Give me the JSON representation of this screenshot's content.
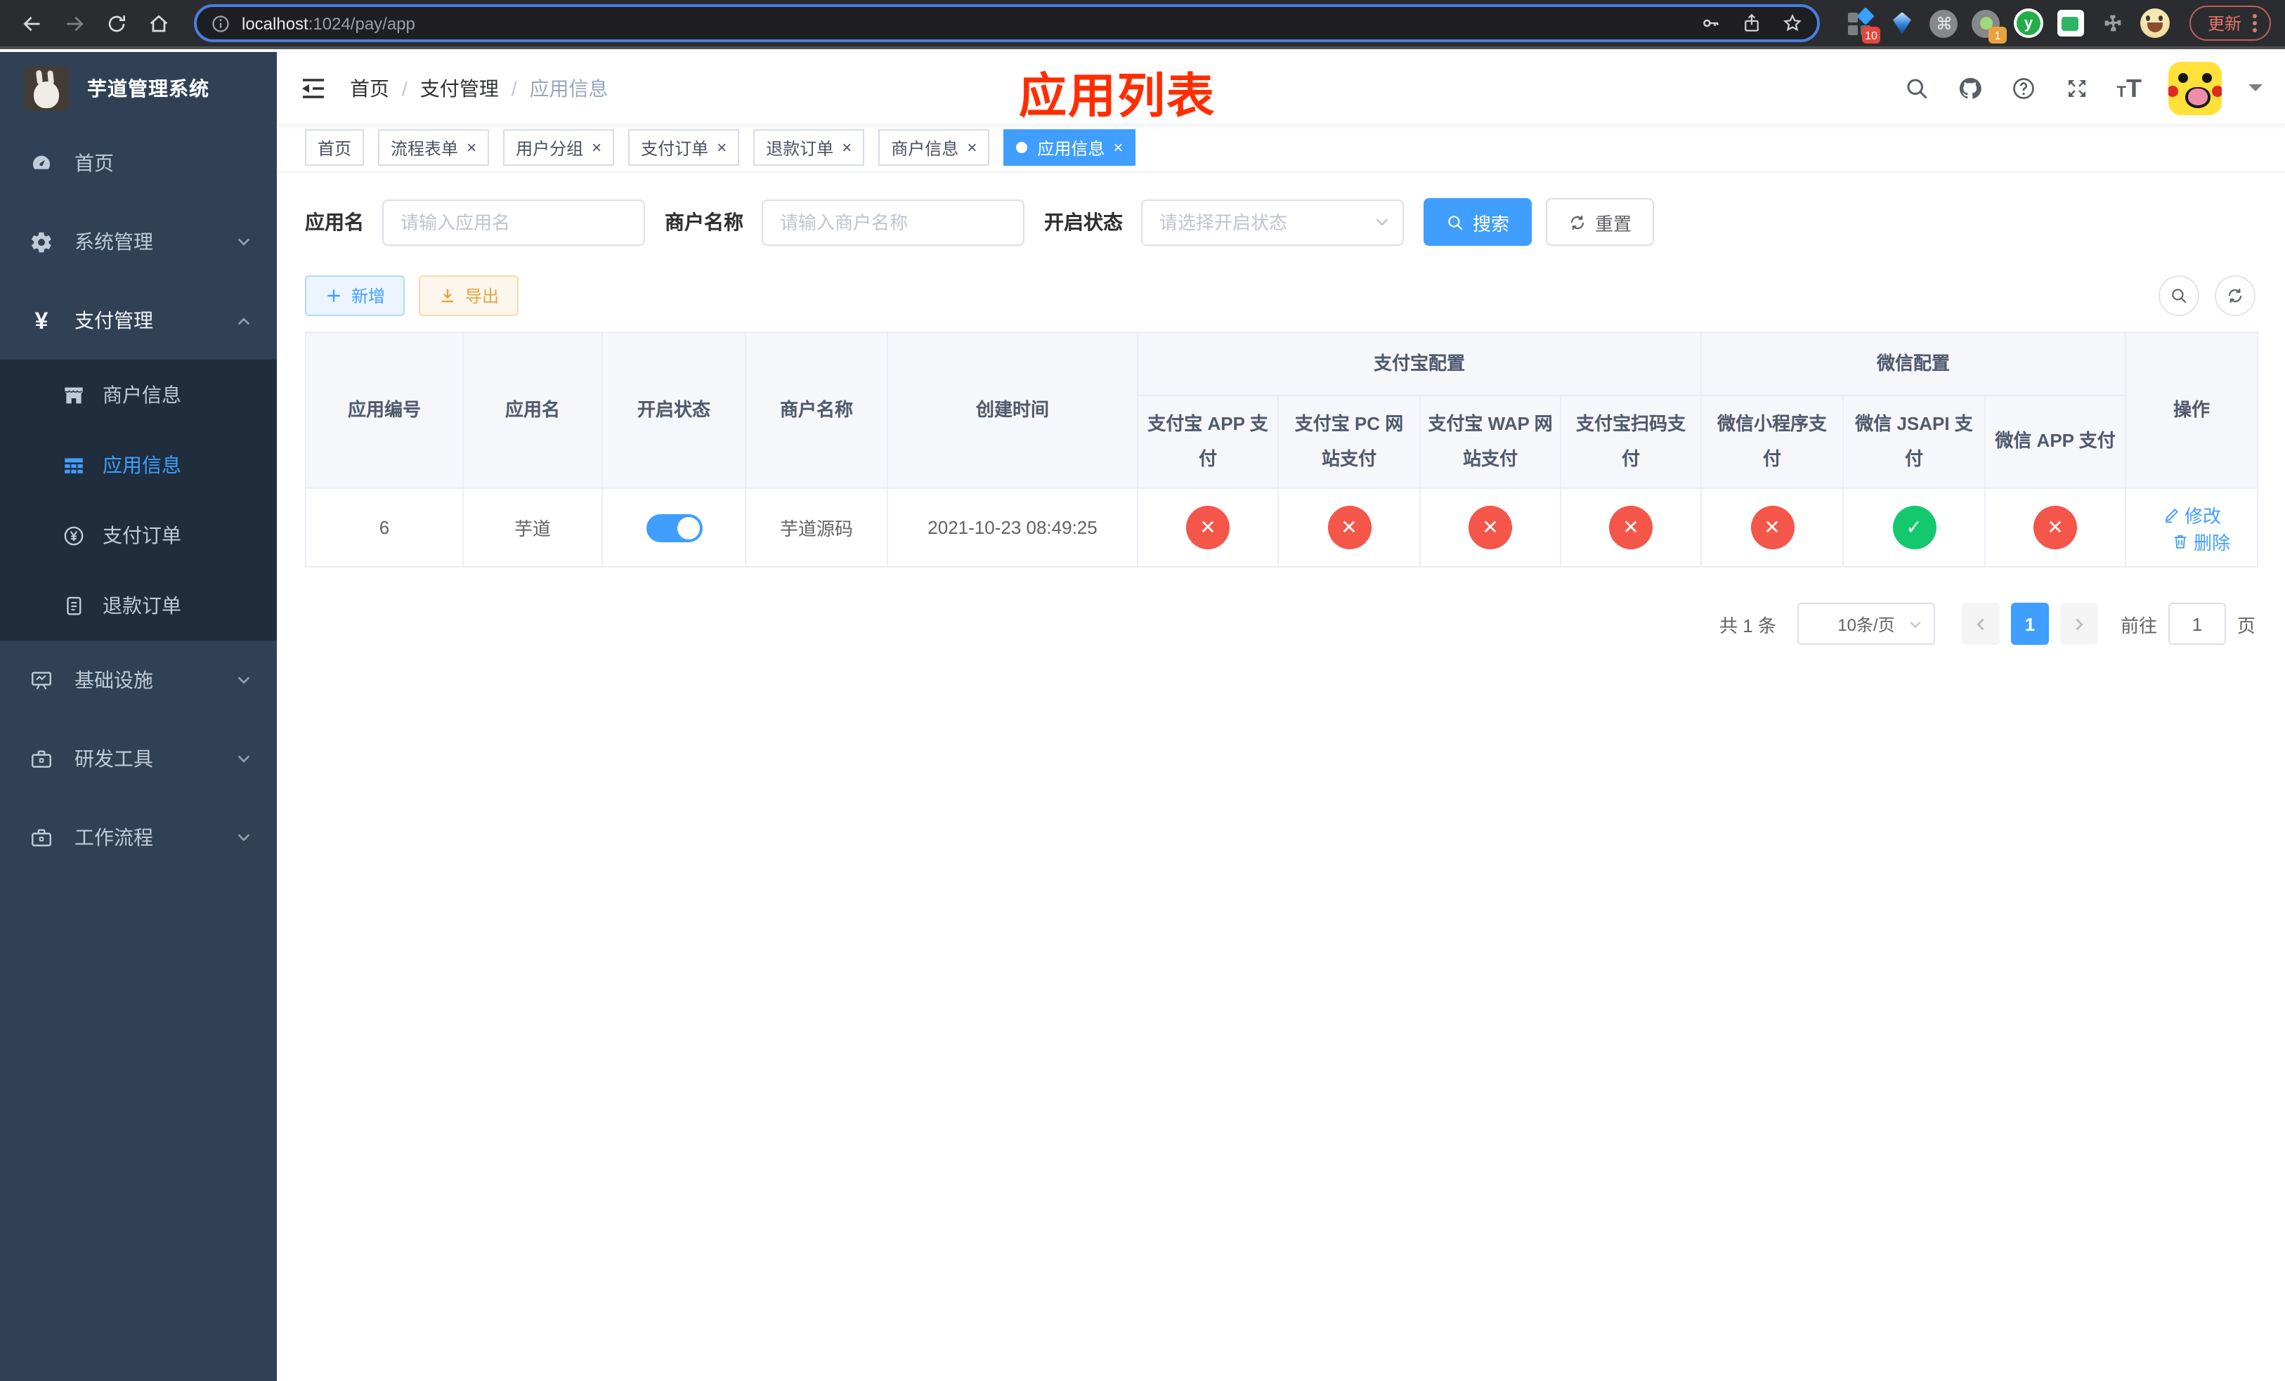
{
  "colors": {
    "accent": "#409eff",
    "success": "#14c86e",
    "danger": "#f4564a",
    "sidebar_bg": "#304156",
    "submenu_bg": "#1f2d3d",
    "annotation": "#ff2d00",
    "active_tab": "#409eff"
  },
  "icons": {
    "close": "×",
    "check": "✓",
    "cross": "✕",
    "command": "⌘",
    "green_ext_letter": "y"
  },
  "browser": {
    "url_host": "localhost",
    "url_path": ":1024/pay/app",
    "ext_badge_10": "10",
    "ext_badge_1": "1",
    "update_label": "更新"
  },
  "sidebar": {
    "title": "芋道管理系统",
    "menu": [
      {
        "label": "首页"
      },
      {
        "label": "系统管理"
      },
      {
        "label": "支付管理"
      },
      {
        "label": "基础设施"
      },
      {
        "label": "研发工具"
      },
      {
        "label": "工作流程"
      }
    ],
    "submenu": [
      {
        "label": "商户信息"
      },
      {
        "label": "应用信息"
      },
      {
        "label": "支付订单"
      },
      {
        "label": "退款订单"
      }
    ]
  },
  "header": {
    "breadcrumb": [
      "首页",
      "支付管理",
      "应用信息"
    ],
    "separator": "/"
  },
  "annotation": {
    "text": "应用列表"
  },
  "tabs": [
    {
      "label": "首页"
    },
    {
      "label": "流程表单"
    },
    {
      "label": "用户分组"
    },
    {
      "label": "支付订单"
    },
    {
      "label": "退款订单"
    },
    {
      "label": "商户信息"
    },
    {
      "label": "应用信息"
    }
  ],
  "filters": {
    "app_name_label": "应用名",
    "app_name_placeholder": "请输入应用名",
    "merchant_label": "商户名称",
    "merchant_placeholder": "请输入商户名称",
    "status_label": "开启状态",
    "status_placeholder": "请选择开启状态",
    "search_label": "搜索",
    "reset_label": "重置"
  },
  "toolbar": {
    "add_label": "新增",
    "export_label": "导出"
  },
  "table": {
    "columns": [
      "应用编号",
      "应用名",
      "开启状态",
      "商户名称",
      "创建时间"
    ],
    "groups": [
      {
        "label": "支付宝配置",
        "children": [
          "支付宝 APP 支付",
          "支付宝 PC 网站支付",
          "支付宝 WAP 网站支付",
          "支付宝扫码支付"
        ]
      },
      {
        "label": "微信配置",
        "children": [
          "微信小程序支付",
          "微信 JSAPI 支付",
          "微信 APP 支付"
        ]
      }
    ],
    "actions_label": "操作",
    "row": {
      "id": "6",
      "name": "芋道",
      "enabled": true,
      "merchant": "芋道源码",
      "created": "2021-10-23 08:49:25",
      "configs": [
        "no",
        "no",
        "no",
        "no",
        "no",
        "yes",
        "no"
      ],
      "edit_label": "修改",
      "delete_label": "删除"
    }
  },
  "pagination": {
    "total": "共 1 条",
    "per_page": "10条/页",
    "page": "1",
    "goto_prefix": "前往",
    "goto_value": "1",
    "goto_suffix": "页"
  }
}
